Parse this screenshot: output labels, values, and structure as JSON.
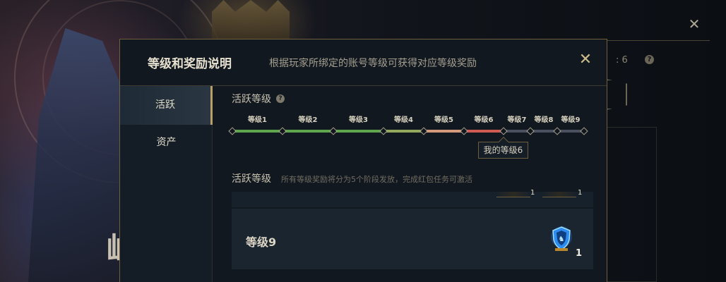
{
  "background": {
    "glyph": "屾",
    "outer_close_icon": "close-icon",
    "outer_fragment": ": 6",
    "outer_help_icon": "?"
  },
  "modal": {
    "title": "等级和奖励说明",
    "subtitle": "根据玩家所绑定的账号等级可获得对应等级奖励",
    "close_icon": "close-icon",
    "close_glyph": "✕",
    "sidebar": {
      "items": [
        {
          "label": "活跃",
          "active": true
        },
        {
          "label": "资产",
          "active": false
        }
      ]
    },
    "activity_levels": {
      "title": "活跃等级",
      "help_glyph": "?",
      "levels": [
        "等级1",
        "等级2",
        "等级3",
        "等级4",
        "等级5",
        "等级6",
        "等级7",
        "等级8",
        "等级9"
      ],
      "current_level": 6,
      "tooltip": "我的等级6",
      "colors": {
        "green": "#5fa54b",
        "olive": "#93a85a",
        "peach": "#d59a7b",
        "red": "#cf5a52",
        "inactive": "#4a5060",
        "node": "#0f161d",
        "node_stroke": "#a69f8c"
      }
    },
    "activity_rewards": {
      "title": "活跃等级",
      "description": "所有等级奖励将分为5个阶段发放，完成红包任务可激活",
      "partial_counts": [
        "1",
        "1"
      ],
      "card": {
        "level_label": "等级9",
        "icon": "blue-shield-trophy-icon",
        "count": "1"
      }
    }
  }
}
